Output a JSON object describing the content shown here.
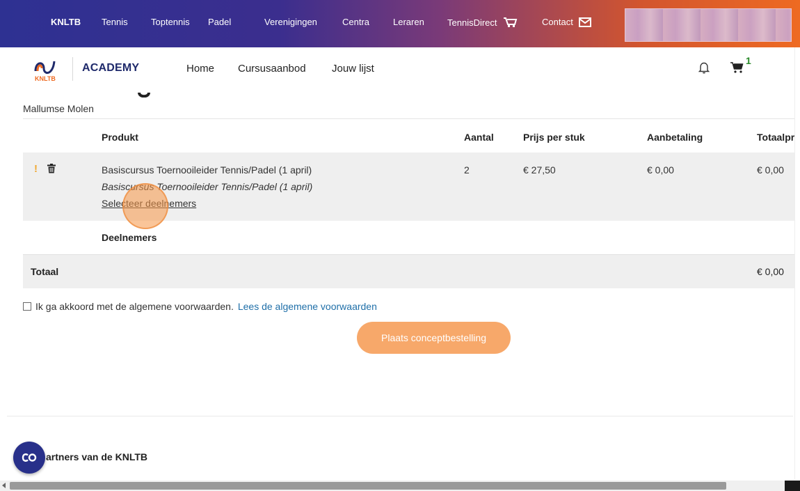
{
  "topnav": {
    "items": [
      "KNLTB",
      "Tennis",
      "Toptennis",
      "Padel",
      "Verenigingen",
      "Centra",
      "Leraren",
      "TennisDirect",
      "Contact"
    ]
  },
  "header": {
    "logo_text": "KNLTB",
    "brand": "ACADEMY",
    "nav": [
      "Home",
      "Cursusaanbod",
      "Jouw lijst"
    ],
    "cart_count": "1"
  },
  "store_name": "Mallumse Molen",
  "table": {
    "headers": [
      "Produkt",
      "Aantal",
      "Prijs per stuk",
      "Aanbetaling",
      "Totaalpr"
    ],
    "product": {
      "warning": "!",
      "name": "Basiscursus Toernooileider Tennis/Padel (1 april)",
      "subtitle": "Basiscursus Toernooileider Tennis/Padel (1 april)",
      "select_link": "Selecteer deelnemers",
      "quantity": "2",
      "price": "€ 27,50",
      "deposit": "€ 0,00",
      "total": "€ 0,00"
    },
    "participants_label": "Deelnemers",
    "total_label": "Totaal",
    "total_value": "€ 0,00"
  },
  "agreement": {
    "text": "Ik ga akkoord met de algemene voorwaarden.",
    "link": "Lees de algemene voorwaarden"
  },
  "cta_label": "Plaats conceptbestelling",
  "footer": {
    "partners_heading": "artners van de KNLTB"
  },
  "colors": {
    "accent_orange": "#f7a86a",
    "brand_navy": "#1f2a6b",
    "link_blue": "#1f6fa8"
  }
}
